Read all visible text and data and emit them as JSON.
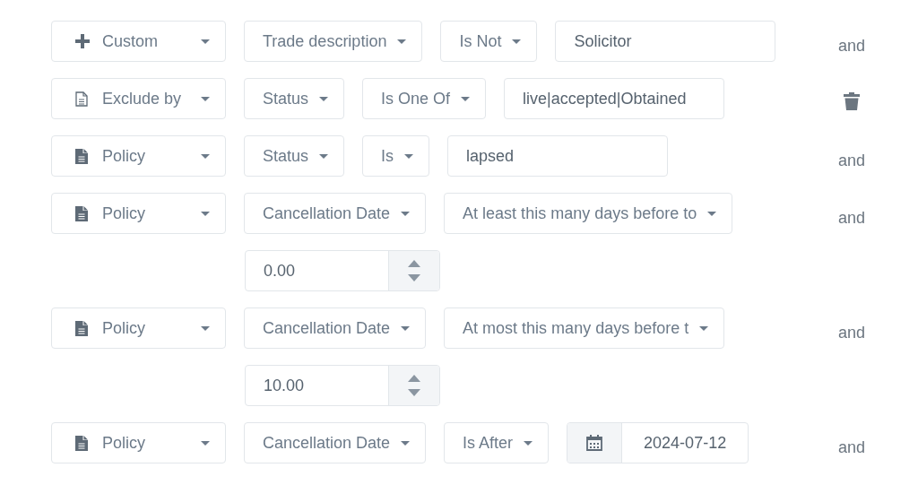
{
  "conditions": [
    {
      "source": {
        "kind": "custom",
        "label": "Custom"
      },
      "field": "Trade description",
      "operator": "Is Not",
      "value": {
        "kind": "text",
        "text": "Solicitor"
      },
      "connector": {
        "kind": "and",
        "text": "and"
      }
    },
    {
      "source": {
        "kind": "exclusion",
        "label": "Exclude by"
      },
      "field": "Status",
      "operator": "Is One Of",
      "value": {
        "kind": "text",
        "text": "live|accepted|Obtained"
      },
      "connector": {
        "kind": "delete"
      }
    },
    {
      "source": {
        "kind": "policy",
        "label": "Policy"
      },
      "field": "Status",
      "operator": "Is",
      "value": {
        "kind": "text",
        "text": "lapsed"
      },
      "connector": {
        "kind": "and",
        "text": "and"
      }
    },
    {
      "source": {
        "kind": "policy",
        "label": "Policy"
      },
      "field": "Cancellation Date",
      "operator": "At least this many days before to",
      "value": {
        "kind": "number",
        "text": "0.00"
      },
      "connector": {
        "kind": "and",
        "text": "and"
      }
    },
    {
      "source": {
        "kind": "policy",
        "label": "Policy"
      },
      "field": "Cancellation Date",
      "operator": "At most this many days before t",
      "value": {
        "kind": "number",
        "text": "10.00"
      },
      "connector": {
        "kind": "and",
        "text": "and"
      }
    },
    {
      "source": {
        "kind": "policy",
        "label": "Policy"
      },
      "field": "Cancellation Date",
      "operator": "Is After",
      "value": {
        "kind": "date",
        "text": "2024-07-12"
      },
      "connector": {
        "kind": "and",
        "text": "and"
      }
    }
  ]
}
